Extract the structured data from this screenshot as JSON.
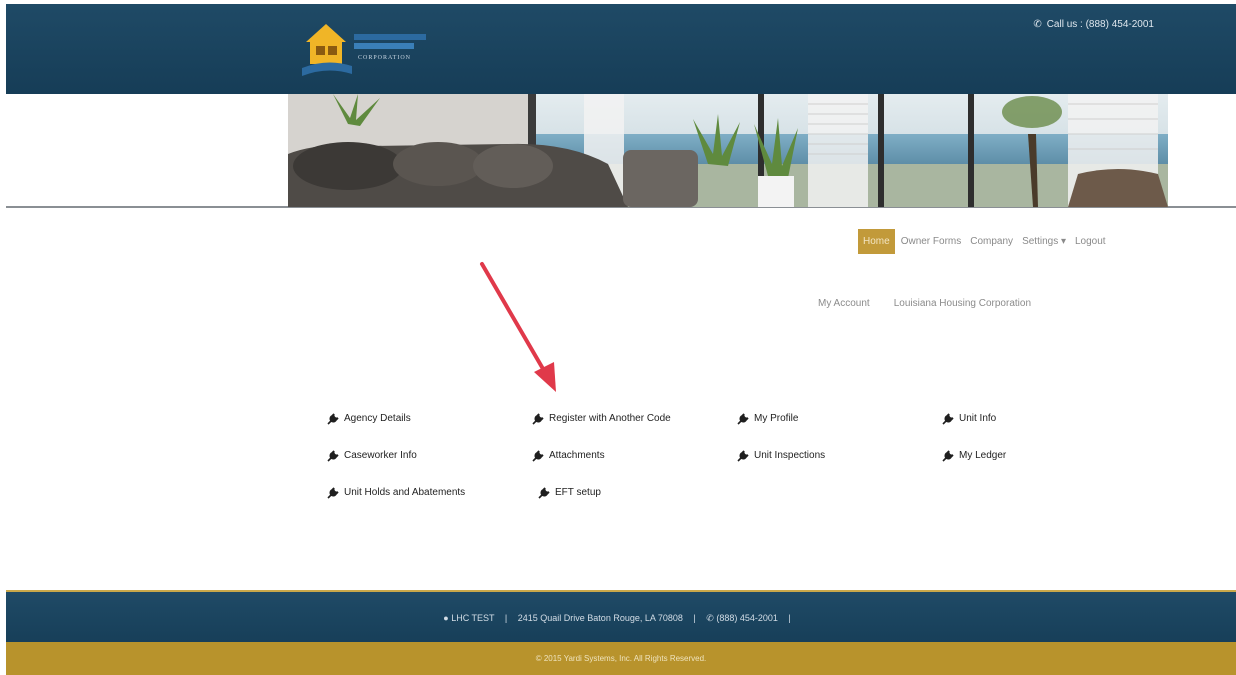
{
  "header": {
    "phone_icon": "phone-icon",
    "phone_text": "Call us : (888) 454-2001"
  },
  "nav": {
    "items": [
      "Home",
      "Owner Forms",
      "Company",
      "Settings ▾",
      "Logout"
    ]
  },
  "account": {
    "my_account": "My Account",
    "organization": "Louisiana Housing Corporation"
  },
  "menu": {
    "rows": [
      [
        "Agency Details",
        "Register with Another Code",
        "My Profile",
        "Unit Info"
      ],
      [
        "Caseworker Info",
        "Attachments",
        "Unit Inspections",
        "My Ledger"
      ],
      [
        "Unit Holds and Abatements",
        "EFT setup"
      ]
    ],
    "icon": "wrench-icon"
  },
  "footer": {
    "location": "LHC TEST",
    "address": "2415 Quail Drive Baton Rouge, LA 70808",
    "phone": "(888) 454-2001",
    "copyright": "© 2015 Yardi Systems, Inc. All Rights Reserved."
  },
  "colors": {
    "header_blue": "#1f4a66",
    "accent_gold": "#c29a3a",
    "arrow_red": "#e0394a"
  }
}
